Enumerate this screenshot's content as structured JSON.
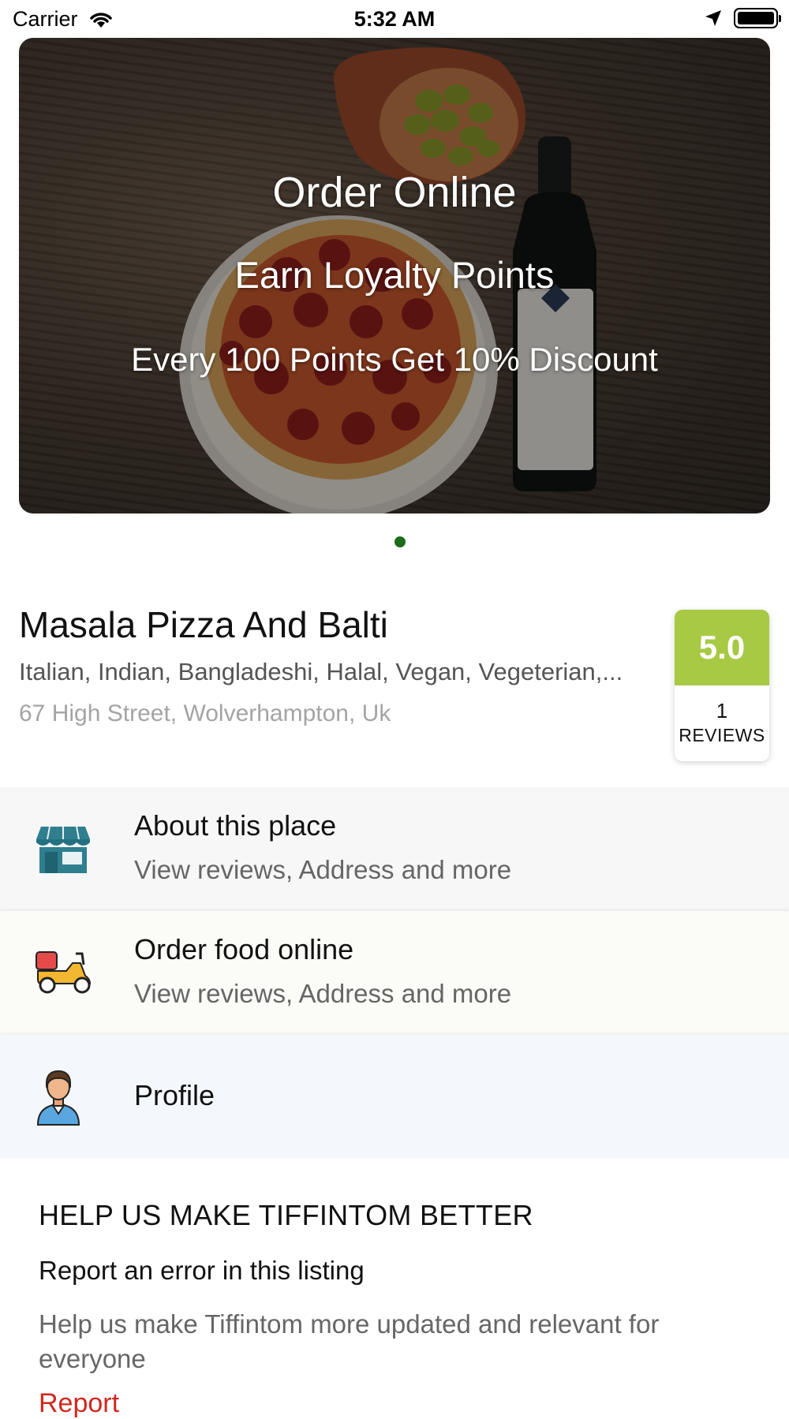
{
  "status_bar": {
    "carrier": "Carrier",
    "time": "5:32 AM",
    "icons": [
      "wifi-icon",
      "location-arrow-icon",
      "battery-icon"
    ]
  },
  "hero": {
    "line1": "Order Online",
    "line2": "Earn Loyalty Points",
    "line3": "Every 100 Points Get 10% Discount",
    "page_indicator_color": "#1a6e1a"
  },
  "restaurant": {
    "name": "Masala Pizza And Balti",
    "cuisines": "Italian, Indian, Bangladeshi, Halal, Vegan, Vegeterian,...",
    "address": "67 High Street, Wolverhampton, Uk",
    "rating": {
      "score": "5.0",
      "count": "1",
      "label": "REVIEWS",
      "color": "#a7c943"
    }
  },
  "menu": {
    "about": {
      "title": "About this place",
      "subtitle": "View reviews, Address and more",
      "icon": "storefront-icon"
    },
    "order": {
      "title": "Order food online",
      "subtitle": "View reviews, Address and more",
      "icon": "delivery-scooter-icon"
    },
    "profile": {
      "title": "Profile",
      "icon": "user-avatar-icon"
    }
  },
  "help": {
    "title": "HELP US MAKE TIFFINTOM BETTER",
    "report_heading": "Report an error in this listing",
    "description": "Help us make Tiffintom more updated and relevant for everyone",
    "link": "Report",
    "link_color": "#d0281f"
  }
}
